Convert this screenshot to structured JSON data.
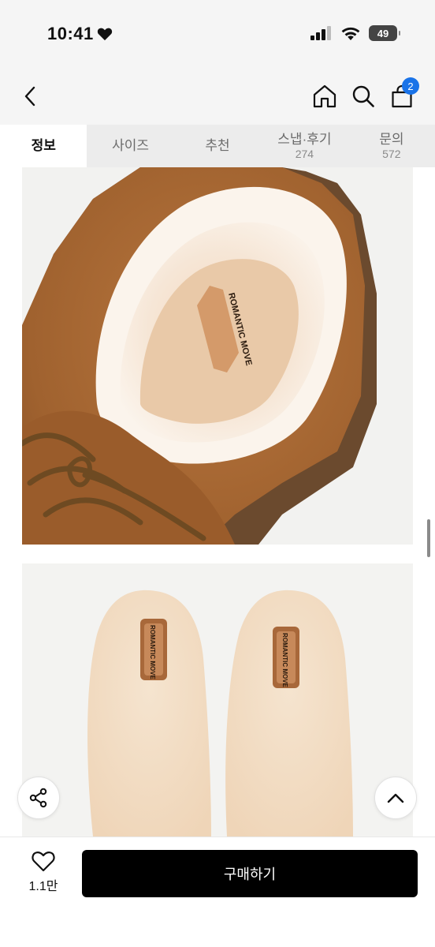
{
  "status_bar": {
    "time": "10:41",
    "battery": "49"
  },
  "header": {
    "back_icon": "chevron-left-icon",
    "home_icon": "home-icon",
    "search_icon": "search-icon",
    "cart_icon": "shopping-bag-icon",
    "cart_badge": "2",
    "accent_color": "#1a73e8"
  },
  "tabs": [
    {
      "label": "정보",
      "count": "",
      "active": true
    },
    {
      "label": "사이즈",
      "count": "",
      "active": false
    },
    {
      "label": "추천",
      "count": "",
      "active": false
    },
    {
      "label": "스냅·후기",
      "count": "274",
      "active": false
    },
    {
      "label": "문의",
      "count": "572",
      "active": false
    }
  ],
  "product": {
    "brand_label_1": "ROMANTIC MOVE",
    "brand_label_2": "ROMANTIC MOVE",
    "brand_label_3": "ROMANTIC MOVE"
  },
  "floating": {
    "share_icon": "share-icon",
    "top_icon": "chevron-up-icon"
  },
  "bottom_bar": {
    "like_icon": "heart-icon",
    "like_count": "1.1만",
    "buy_label": "구매하기"
  }
}
